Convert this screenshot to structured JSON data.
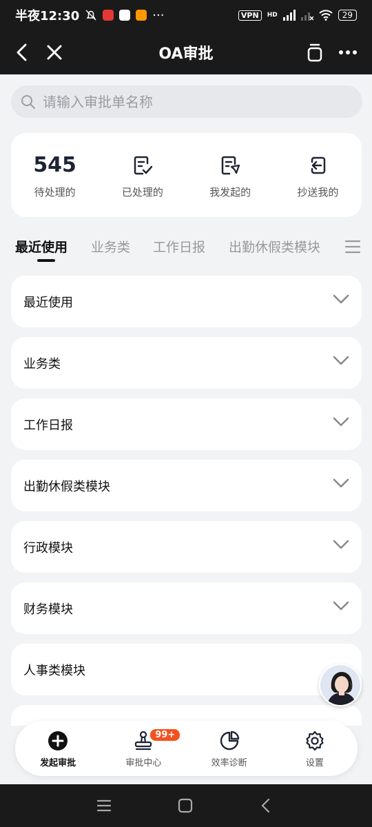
{
  "status_bar": {
    "time": "半夜12:30",
    "dots": "···",
    "vpn": "VPN",
    "network": "HD",
    "battery": "29"
  },
  "nav": {
    "title": "OA审批",
    "back_icon": "back-arrow-icon",
    "close_icon": "close-icon"
  },
  "search": {
    "placeholder": "请输入审批单名称"
  },
  "stats": [
    {
      "value": "545",
      "label": "待处理的"
    },
    {
      "icon": "document-check-icon",
      "label": "已处理的"
    },
    {
      "icon": "document-send-icon",
      "label": "我发起的"
    },
    {
      "icon": "cc-inbox-icon",
      "label": "抄送我的"
    }
  ],
  "tabs": [
    "最近使用",
    "业务类",
    "工作日报",
    "出勤休假类模块"
  ],
  "categories": [
    "最近使用",
    "业务类",
    "工作日报",
    "出勤休假类模块",
    "行政模块",
    "财务模块",
    "人事类模块"
  ],
  "bottom_nav": [
    {
      "label": "发起审批",
      "icon": "plus-circle-icon"
    },
    {
      "label": "审批中心",
      "icon": "stamp-icon",
      "badge": "99+"
    },
    {
      "label": "效率诊断",
      "icon": "pie-chart-icon"
    },
    {
      "label": "设置",
      "icon": "gear-icon"
    }
  ],
  "colors": {
    "dark_bar": "#1a1a1a",
    "background": "#f2f3f5",
    "badge": "#f4511e"
  }
}
